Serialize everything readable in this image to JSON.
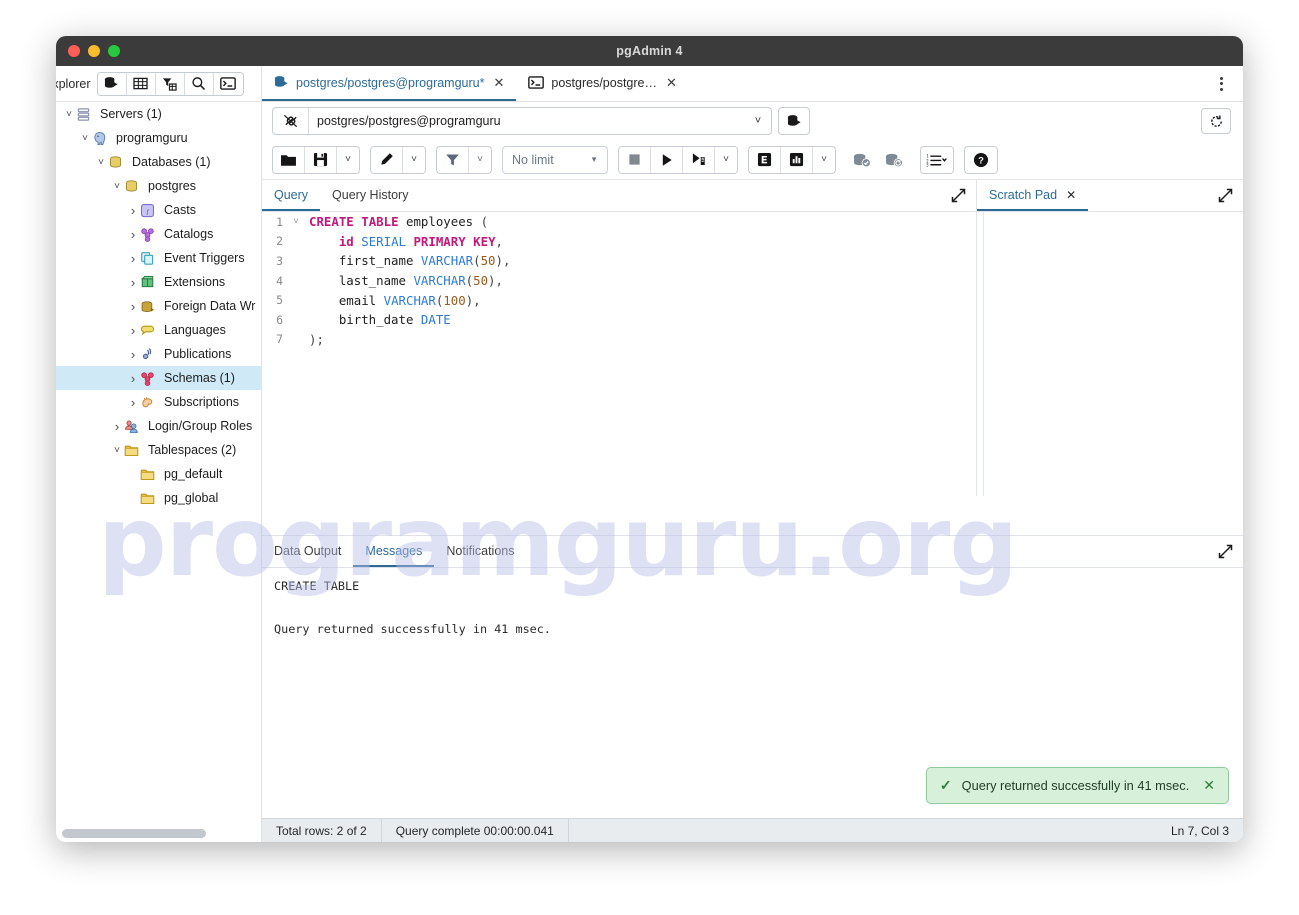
{
  "window": {
    "title": "pgAdmin 4",
    "controls": [
      "close-red",
      "minimize-amber",
      "maximize-green"
    ]
  },
  "watermark": {
    "text": "programguru.org",
    "color": "#b9bde8"
  },
  "explorer": {
    "label": "Explorer",
    "toolbar_icons": [
      "object-explorer-icon",
      "grid-icon",
      "filter-tree-icon",
      "search-icon",
      "terminal-icon"
    ],
    "tree": [
      {
        "label": "Servers (1)",
        "depth": 0,
        "state": "expanded",
        "icon": "servers-icon",
        "selected": false
      },
      {
        "label": "programguru",
        "depth": 1,
        "state": "expanded",
        "icon": "postgres-elephant-icon",
        "selected": false
      },
      {
        "label": "Databases (1)",
        "depth": 2,
        "state": "expanded",
        "icon": "databases-icon",
        "selected": false
      },
      {
        "label": "postgres",
        "depth": 3,
        "state": "expanded",
        "icon": "database-icon",
        "selected": false
      },
      {
        "label": "Casts",
        "depth": 4,
        "state": "collapsed",
        "icon": "casts-icon",
        "selected": false
      },
      {
        "label": "Catalogs",
        "depth": 4,
        "state": "collapsed",
        "icon": "catalogs-icon",
        "selected": false
      },
      {
        "label": "Event Triggers",
        "depth": 4,
        "state": "collapsed",
        "icon": "event-triggers-icon",
        "selected": false
      },
      {
        "label": "Extensions",
        "depth": 4,
        "state": "collapsed",
        "icon": "extensions-icon",
        "selected": false
      },
      {
        "label": "Foreign Data Wr",
        "depth": 4,
        "state": "collapsed",
        "icon": "foreign-data-wrappers-icon",
        "selected": false
      },
      {
        "label": "Languages",
        "depth": 4,
        "state": "collapsed",
        "icon": "languages-icon",
        "selected": false
      },
      {
        "label": "Publications",
        "depth": 4,
        "state": "collapsed",
        "icon": "publications-icon",
        "selected": false
      },
      {
        "label": "Schemas (1)",
        "depth": 4,
        "state": "collapsed",
        "icon": "schemas-icon",
        "selected": true
      },
      {
        "label": "Subscriptions",
        "depth": 4,
        "state": "collapsed",
        "icon": "subscriptions-icon",
        "selected": false
      },
      {
        "label": "Login/Group Roles",
        "depth": 3,
        "state": "collapsed",
        "icon": "login-roles-icon",
        "selected": false
      },
      {
        "label": "Tablespaces (2)",
        "depth": 3,
        "state": "expanded",
        "icon": "tablespaces-icon",
        "selected": false
      },
      {
        "label": "pg_default",
        "depth": 4,
        "state": "leaf",
        "icon": "folder-icon",
        "selected": false
      },
      {
        "label": "pg_global",
        "depth": 4,
        "state": "leaf",
        "icon": "folder-icon",
        "selected": false
      }
    ]
  },
  "tabs": [
    {
      "label": "postgres/postgres@programguru*",
      "icon": "query-tool-icon",
      "active": true,
      "closable": true
    },
    {
      "label": "postgres/postgre…",
      "icon": "psql-terminal-icon",
      "active": false,
      "closable": true
    }
  ],
  "connection": {
    "icon": "connection-icon",
    "value": "postgres/postgres@programguru",
    "caret": "chevron-down-icon",
    "db_button_icon": "database-select-icon",
    "reset_icon": "reset-layout-icon"
  },
  "toolbar": {
    "open_file": "folder-open-icon",
    "save_file": "save-icon",
    "save_caret": "chevron-down-icon",
    "edit": "pencil-icon",
    "edit_caret": "chevron-down-icon",
    "filter": "filter-icon",
    "filter_caret": "chevron-down-icon",
    "limit_value": "No limit",
    "limit_caret": "triangle-down-icon",
    "stop": "stop-icon",
    "execute": "play-icon",
    "execute_script": "play-script-icon",
    "execute_caret": "chevron-down-icon",
    "explain": "explain-icon",
    "explain_analyze": "explain-analyze-icon",
    "explain_caret": "chevron-down-icon",
    "commit": "commit-icon",
    "rollback": "rollback-icon",
    "macros": "macros-list-icon",
    "macros_caret": "chevron-down-icon",
    "help": "help-icon"
  },
  "query_panel": {
    "tabs": [
      {
        "label": "Query",
        "active": true
      },
      {
        "label": "Query History",
        "active": false
      }
    ],
    "expand_icon": "expand-icon",
    "lines": [
      {
        "n": "1",
        "fold": "chevron-down-icon",
        "tokens": [
          {
            "t": "CREATE",
            "c": "k-key"
          },
          {
            "t": " ",
            "c": "k-id"
          },
          {
            "t": "TABLE",
            "c": "k-key"
          },
          {
            "t": " employees ",
            "c": "k-id"
          },
          {
            "t": "(",
            "c": "k-pun"
          }
        ]
      },
      {
        "n": "2",
        "fold": "",
        "tokens": [
          {
            "t": "    ",
            "c": "k-id"
          },
          {
            "t": "id",
            "c": "k-key"
          },
          {
            "t": " ",
            "c": "k-id"
          },
          {
            "t": "SERIAL",
            "c": "k-type"
          },
          {
            "t": " ",
            "c": "k-id"
          },
          {
            "t": "PRIMARY KEY",
            "c": "k-key"
          },
          {
            "t": ",",
            "c": "k-pun"
          }
        ]
      },
      {
        "n": "3",
        "fold": "",
        "tokens": [
          {
            "t": "    first_name ",
            "c": "k-id"
          },
          {
            "t": "VARCHAR",
            "c": "k-type"
          },
          {
            "t": "(",
            "c": "k-pun"
          },
          {
            "t": "50",
            "c": "k-num"
          },
          {
            "t": ")",
            "c": "k-pun"
          },
          {
            "t": ",",
            "c": "k-pun"
          }
        ]
      },
      {
        "n": "4",
        "fold": "",
        "tokens": [
          {
            "t": "    last_name ",
            "c": "k-id"
          },
          {
            "t": "VARCHAR",
            "c": "k-type"
          },
          {
            "t": "(",
            "c": "k-pun"
          },
          {
            "t": "50",
            "c": "k-num"
          },
          {
            "t": ")",
            "c": "k-pun"
          },
          {
            "t": ",",
            "c": "k-pun"
          }
        ]
      },
      {
        "n": "5",
        "fold": "",
        "tokens": [
          {
            "t": "    email ",
            "c": "k-id"
          },
          {
            "t": "VARCHAR",
            "c": "k-type"
          },
          {
            "t": "(",
            "c": "k-pun"
          },
          {
            "t": "100",
            "c": "k-num"
          },
          {
            "t": ")",
            "c": "k-pun"
          },
          {
            "t": ",",
            "c": "k-pun"
          }
        ]
      },
      {
        "n": "6",
        "fold": "",
        "tokens": [
          {
            "t": "    birth_date ",
            "c": "k-id"
          },
          {
            "t": "DATE",
            "c": "k-type"
          }
        ]
      },
      {
        "n": "7",
        "fold": "",
        "tokens": [
          {
            "t": ")",
            "c": "k-pun"
          },
          {
            "t": ";",
            "c": "k-pun"
          }
        ]
      }
    ]
  },
  "scratch_pad": {
    "tab_label": "Scratch Pad",
    "close_icon": "close-icon",
    "expand_icon": "expand-icon",
    "content": ""
  },
  "output_panel": {
    "tabs": [
      {
        "label": "Data Output",
        "active": false
      },
      {
        "label": "Messages",
        "active": true
      },
      {
        "label": "Notifications",
        "active": false
      }
    ],
    "expand_icon": "expand-icon",
    "message_line1": "CREATE TABLE",
    "message_line2": "Query returned successfully in 41 msec."
  },
  "toast": {
    "check_icon": "check-icon",
    "text": "Query returned successfully in 41 msec.",
    "close_icon": "close-icon",
    "bg": "#d6f0da",
    "border": "#93ca9d"
  },
  "statusbar": {
    "total_rows": "Total rows: 2 of 2",
    "query_complete": "Query complete 00:00:00.041",
    "cursor": "Ln 7, Col 3"
  }
}
